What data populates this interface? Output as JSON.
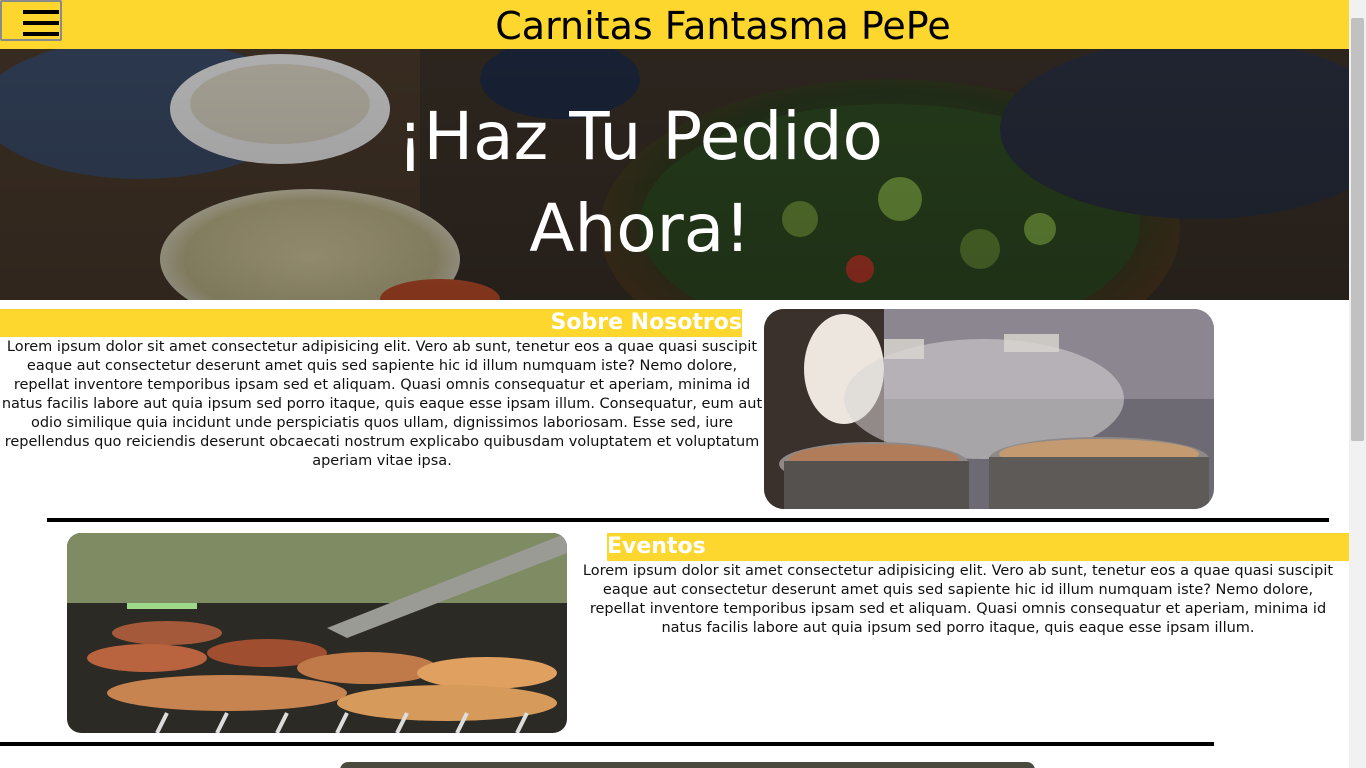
{
  "header": {
    "title": "Carnitas Fantasma PePe",
    "menu_icon": "hamburger-icon"
  },
  "hero": {
    "title": "¡Haz Tu Pedido Ahora!"
  },
  "about": {
    "heading": "Sobre Nosotros",
    "text": "Lorem ipsum dolor sit amet consectetur adipisicing elit. Vero ab sunt, tenetur eos a quae quasi suscipit eaque aut consectetur deserunt amet quis sed sapiente hic id illum numquam iste? Nemo dolore, repellat inventore temporibus ipsam sed et aliquam. Quasi omnis consequatur et aperiam, minima id natus facilis labore aut quia ipsum sed porro itaque, quis eaque esse ipsam illum. Consequatur, eum aut odio similique quia incidunt unde perspiciatis quos ullam, dignissimos laboriosam. Esse sed, iure repellendus quo reiciendis deserunt obcaecati nostrum explicabo quibusdam voluptatem et voluptatum aperiam vitae ipsa."
  },
  "events": {
    "heading": "Eventos",
    "text": "Lorem ipsum dolor sit amet consectetur adipisicing elit. Vero ab sunt, tenetur eos a quae quasi suscipit eaque aut consectetur deserunt amet quis sed sapiente hic id illum numquam iste? Nemo dolore, repellat inventore temporibus ipsam sed et aliquam. Quasi omnis consequatur et aperiam, minima id natus facilis labore aut quia ipsum sed porro itaque, quis eaque esse ipsam illum."
  },
  "colors": {
    "accent": "#FDD72E",
    "divider": "#000000"
  }
}
